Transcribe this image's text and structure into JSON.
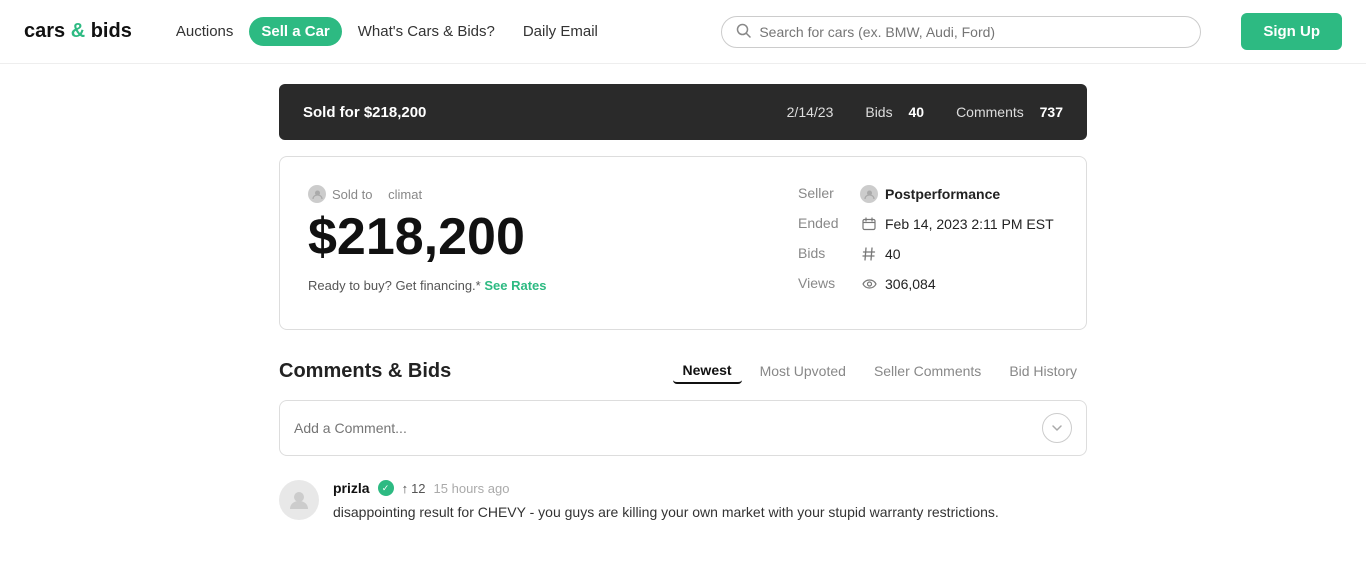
{
  "header": {
    "logo_text": "cars",
    "logo_ampersand": " & ",
    "logo_brand": "bids",
    "nav": [
      {
        "id": "auctions",
        "label": "Auctions",
        "style": "normal"
      },
      {
        "id": "sell",
        "label": "Sell a Car",
        "style": "sell"
      },
      {
        "id": "whats",
        "label": "What's Cars & Bids?",
        "style": "normal"
      },
      {
        "id": "daily",
        "label": "Daily Email",
        "style": "normal"
      }
    ],
    "search_placeholder": "Search for cars (ex. BMW, Audi, Ford)",
    "signup_label": "Sign Up"
  },
  "sold_banner": {
    "sold_label": "Sold for $218,200",
    "date": "2/14/23",
    "bids_label": "Bids",
    "bids_count": "40",
    "comments_label": "Comments",
    "comments_count": "737"
  },
  "detail": {
    "sold_to_label": "Sold to",
    "buyer": "climat",
    "price": "$218,200",
    "financing_text": "Ready to buy? Get financing.*",
    "financing_link": "See Rates",
    "seller_label": "Seller",
    "seller_name": "Postperformance",
    "ended_label": "Ended",
    "ended_value": "Feb 14, 2023 2:11 PM EST",
    "bids_label": "Bids",
    "bids_value": "40",
    "views_label": "Views",
    "views_value": "306,084"
  },
  "comments_section": {
    "title": "Comments & Bids",
    "tabs": [
      {
        "id": "newest",
        "label": "Newest",
        "active": true
      },
      {
        "id": "most_upvoted",
        "label": "Most Upvoted",
        "active": false
      },
      {
        "id": "seller_comments",
        "label": "Seller Comments",
        "active": false
      },
      {
        "id": "bid_history",
        "label": "Bid History",
        "active": false
      }
    ],
    "input_placeholder": "Add a Comment...",
    "comments": [
      {
        "id": "comment-1",
        "user": "prizla",
        "verified": true,
        "upvotes": "12",
        "time": "15 hours ago",
        "text": "disappointing result for CHEVY - you guys are killing your own market with your stupid warranty restrictions."
      }
    ]
  }
}
